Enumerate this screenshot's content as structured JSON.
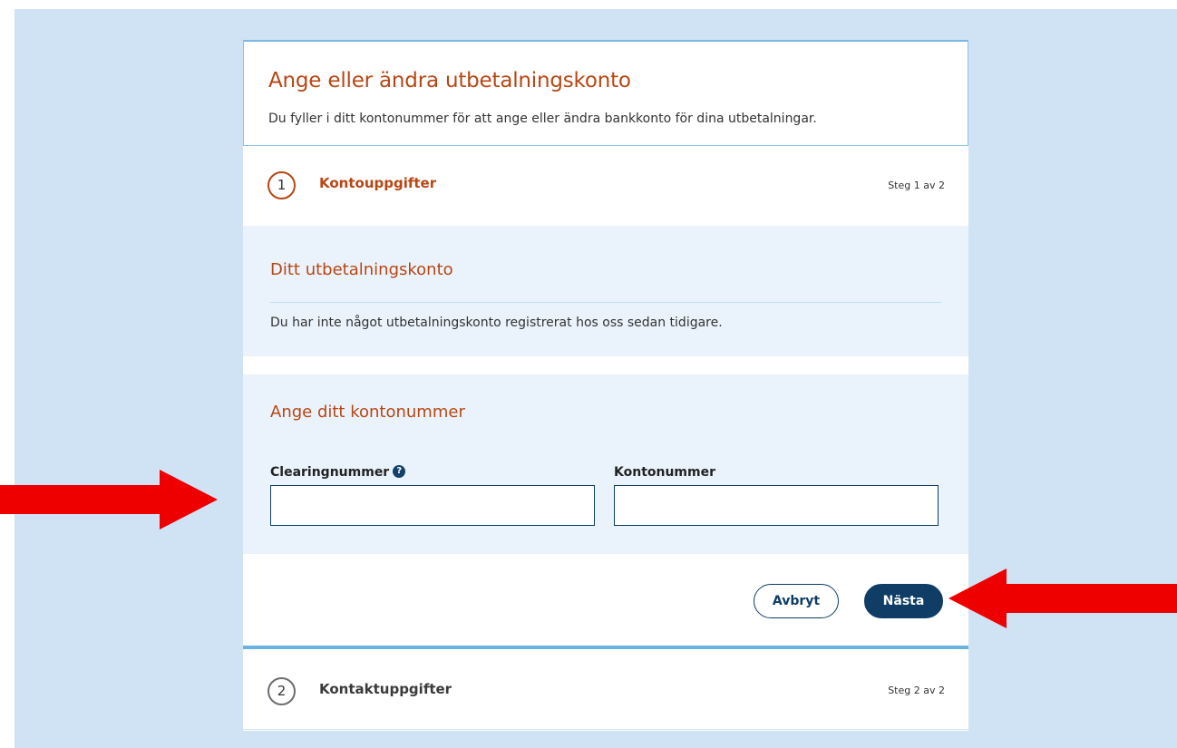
{
  "header": {
    "title": "Ange eller ändra utbetalningskonto",
    "subtitle": "Du fyller i ditt kontonummer för att ange eller ändra bankkonto för dina utbetalningar."
  },
  "steps": [
    {
      "number": "1",
      "label": "Kontouppgifter",
      "count": "Steg 1 av 2"
    },
    {
      "number": "2",
      "label": "Kontaktuppgifter",
      "count": "Steg 2 av 2"
    }
  ],
  "account_panel": {
    "title": "Ditt utbetalningskonto",
    "text": "Du har inte något utbetalningskonto registrerat hos oss sedan tidigare."
  },
  "form": {
    "title": "Ange ditt kontonummer",
    "clearing_label": "Clearingnummer",
    "clearing_value": "",
    "account_label": "Kontonummer",
    "account_value": ""
  },
  "buttons": {
    "cancel": "Avbryt",
    "next": "Nästa"
  },
  "icons": {
    "help": "question-circle-icon",
    "annotation_arrow": "red-arrow-icon"
  },
  "colors": {
    "accent": "#b84614",
    "primary": "#0f3d66",
    "background": "#cfe3f4",
    "panel": "#eaf3fb",
    "annotation": "#ee0000"
  }
}
